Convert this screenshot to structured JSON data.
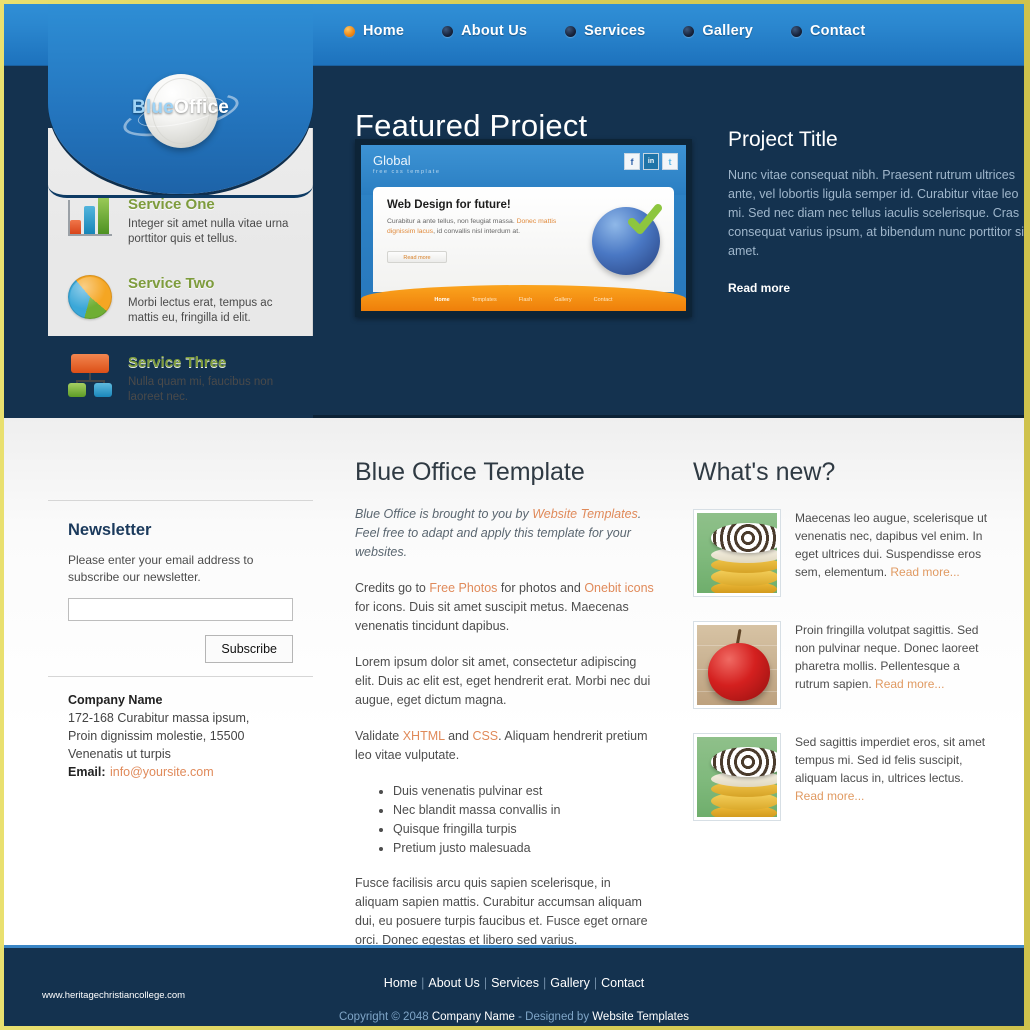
{
  "brand": {
    "name_first": "Blue",
    "name_second": "Office",
    "logo_icon": "sphere-planet-icon"
  },
  "nav": {
    "items": [
      {
        "label": "Home",
        "active": true
      },
      {
        "label": "About Us",
        "active": false
      },
      {
        "label": "Services",
        "active": false
      },
      {
        "label": "Gallery",
        "active": false
      },
      {
        "label": "Contact",
        "active": false
      }
    ]
  },
  "sidebar": {
    "services": [
      {
        "icon": "bar-chart-icon",
        "title": "Service One",
        "desc": "Integer sit amet nulla vitae urna porttitor quis et tellus."
      },
      {
        "icon": "pie-chart-icon",
        "title": "Service Two",
        "desc": "Morbi lectus erat, tempus ac mattis eu, fringilla id elit."
      },
      {
        "icon": "org-chart-icon",
        "title": "Service Three",
        "desc": "Nulla quam mi, faucibus non laoreet nec."
      }
    ],
    "newsletter": {
      "heading": "Newsletter",
      "text": "Please enter your email address to subscribe our newsletter.",
      "input_value": "",
      "input_placeholder": "",
      "button_label": "Subscribe"
    },
    "company": {
      "name": "Company Name",
      "address_line1": "172-168 Curabitur massa ipsum,",
      "address_line2": "Proin dignissim molestie, 15500",
      "address_line3": "Venenatis ut turpis",
      "email_label": "Email:",
      "email_value": "info@yoursite.com"
    }
  },
  "hero": {
    "title": "Featured Project",
    "screenshot": {
      "brand": "Global",
      "brand_sub": "free css template",
      "social": [
        "f",
        "in",
        "t"
      ],
      "headline": "Web Design for future!",
      "body_before": "Curabitur a ante tellus, non feugiat massa. ",
      "body_link": "Donec mattis dignissim lacus",
      "body_after": ", id convallis nisl interdum at.",
      "button": "Read more",
      "nav": [
        "Home",
        "Templates",
        "Flash",
        "Gallery",
        "Contact"
      ]
    },
    "project": {
      "title": "Project Title",
      "body": "Nunc vitae consequat nibh. Praesent rutrum ultrices ante, vel lobortis ligula semper id. Curabitur vitae leo mi. Sed nec diam nec tellus iaculis scelerisque. Cras consequat varius ipsum, at bibendum nunc porttitor sit amet.",
      "read_more": "Read more"
    }
  },
  "main": {
    "heading": "Blue Office Template",
    "intro_before": "Blue Office is brought to you by ",
    "intro_link": "Website Templates",
    "intro_after": ". Feel free to adapt and apply this template for your websites.",
    "credits_before": "Credits go to ",
    "credits_link1": "Free Photos",
    "credits_mid": " for photos and ",
    "credits_link2": "Onebit icons",
    "credits_after": " for icons. Duis sit amet suscipit metus. Maecenas venenatis tincidunt dapibus.",
    "para_lorem": "Lorem ipsum dolor sit amet, consectetur adipiscing elit. Duis ac elit est, eget hendrerit erat. Morbi nec dui augue, eget dictum magna.",
    "validate_before": "Validate ",
    "validate_link1": "XHTML",
    "validate_mid": " and ",
    "validate_link2": "CSS",
    "validate_after": ". Aliquam hendrerit pretium leo vitae vulputate.",
    "bullets": [
      "Duis venenatis pulvinar est",
      "Nec blandit massa convallis in",
      "Quisque fringilla turpis",
      "Pretium justo malesuada"
    ],
    "para_last": "Fusce facilisis arcu quis sapien scelerisque, in aliquam sapien mattis. Curabitur accumsan aliquam dui, eu posuere turpis faucibus et. Fusce eget ornare orci. Donec egestas et libero sed varius."
  },
  "news": {
    "heading": "What's new?",
    "items": [
      {
        "thumb": "stacked-plates-photo",
        "text": "Maecenas leo augue, scelerisque ut venenatis nec, dapibus vel enim. In eget ultrices dui. Suspendisse eros sem, elementum. ",
        "link": "Read more..."
      },
      {
        "thumb": "red-apple-photo",
        "text": "Proin fringilla volutpat sagittis. Sed non pulvinar neque. Donec laoreet pharetra mollis. Pellentesque a rutrum sapien. ",
        "link": "Read more..."
      },
      {
        "thumb": "stacked-plates-photo",
        "text": "Sed sagittis imperdiet eros, sit amet tempus mi. Sed id felis suscipit, aliquam lacus in, ultrices lectus. ",
        "link": "Read more..."
      }
    ]
  },
  "footer": {
    "url": "www.heritagechristiancollege.com",
    "nav": [
      "Home",
      "About Us",
      "Services",
      "Gallery",
      "Contact"
    ],
    "copyright_before": "Copyright © 2048 ",
    "copyright_company": "Company Name",
    "copyright_mid": " - Designed by ",
    "copyright_link": "Website Templates"
  },
  "colors": {
    "header_blue": "#2b87cf",
    "hero_navy": "#14324f",
    "accent_gold": "#d9cf58",
    "service_green": "#7e9c3d",
    "link_orange": "#e08a5a"
  }
}
